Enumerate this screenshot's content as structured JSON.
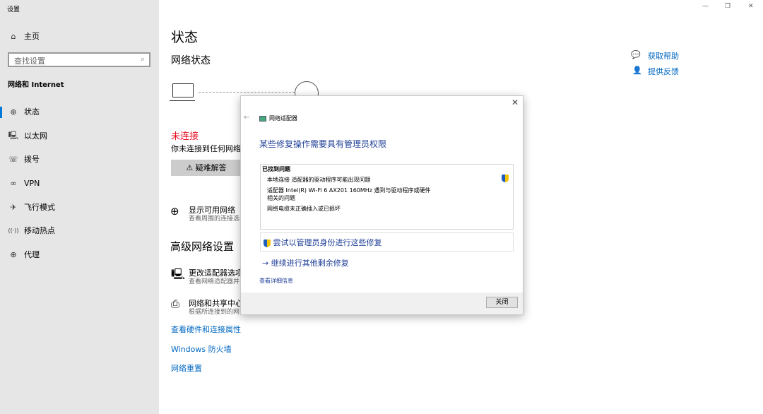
{
  "window": {
    "title": "设置",
    "controls": [
      "—",
      "❐",
      "✕"
    ]
  },
  "sidebar": {
    "home": "主页",
    "search_placeholder": "查找设置",
    "section": "网络和 Internet",
    "items": [
      {
        "icon": "⊕",
        "label": "状态"
      },
      {
        "icon": "🖳",
        "label": "以太网"
      },
      {
        "icon": "☏",
        "label": "拨号"
      },
      {
        "icon": "∞",
        "label": "VPN"
      },
      {
        "icon": "✈",
        "label": "飞行模式"
      },
      {
        "icon": "((·))",
        "label": "移动热点"
      },
      {
        "icon": "⊕",
        "label": "代理"
      }
    ]
  },
  "main": {
    "title": "状态",
    "network_status": "网络状态",
    "not_connected": "未连接",
    "not_connected_desc": "你未连接到任何网络。",
    "troubleshoot": "疑难解答",
    "show_networks": {
      "title": "显示可用网络",
      "desc": "查看周围的连接选"
    },
    "advanced": "高级网络设置",
    "adapter": {
      "title": "更改适配器选项",
      "desc": "查看网络适配器并"
    },
    "sharing": {
      "title": "网络和共享中心",
      "desc": "根据所连接到的网"
    },
    "links": [
      "查看硬件和连接属性",
      "Windows 防火墙",
      "网络重置"
    ]
  },
  "help": {
    "get_help": "获取帮助",
    "feedback": "提供反馈"
  },
  "dialog": {
    "nav_title": "网络适配器",
    "heading": "某些修复操作需要具有管理员权限",
    "found": "已找到问题",
    "problems": [
      "本地连接 适配器的驱动程序可能出现问题",
      "适配器 Intel(R) Wi-Fi 6 AX201 160MHz 遇到与驱动程序或硬件",
      "相关的问题",
      "网络电缆未正确插入或已损坏"
    ],
    "admin_fix": "尝试以管理员身份进行这些修复",
    "continue": "继续进行其他剩余修复",
    "details": "查看详细信息",
    "close": "关闭"
  },
  "colors": {
    "accent": "#0067c0",
    "error": "#e81123",
    "sidebar": "#e6e6e6"
  }
}
